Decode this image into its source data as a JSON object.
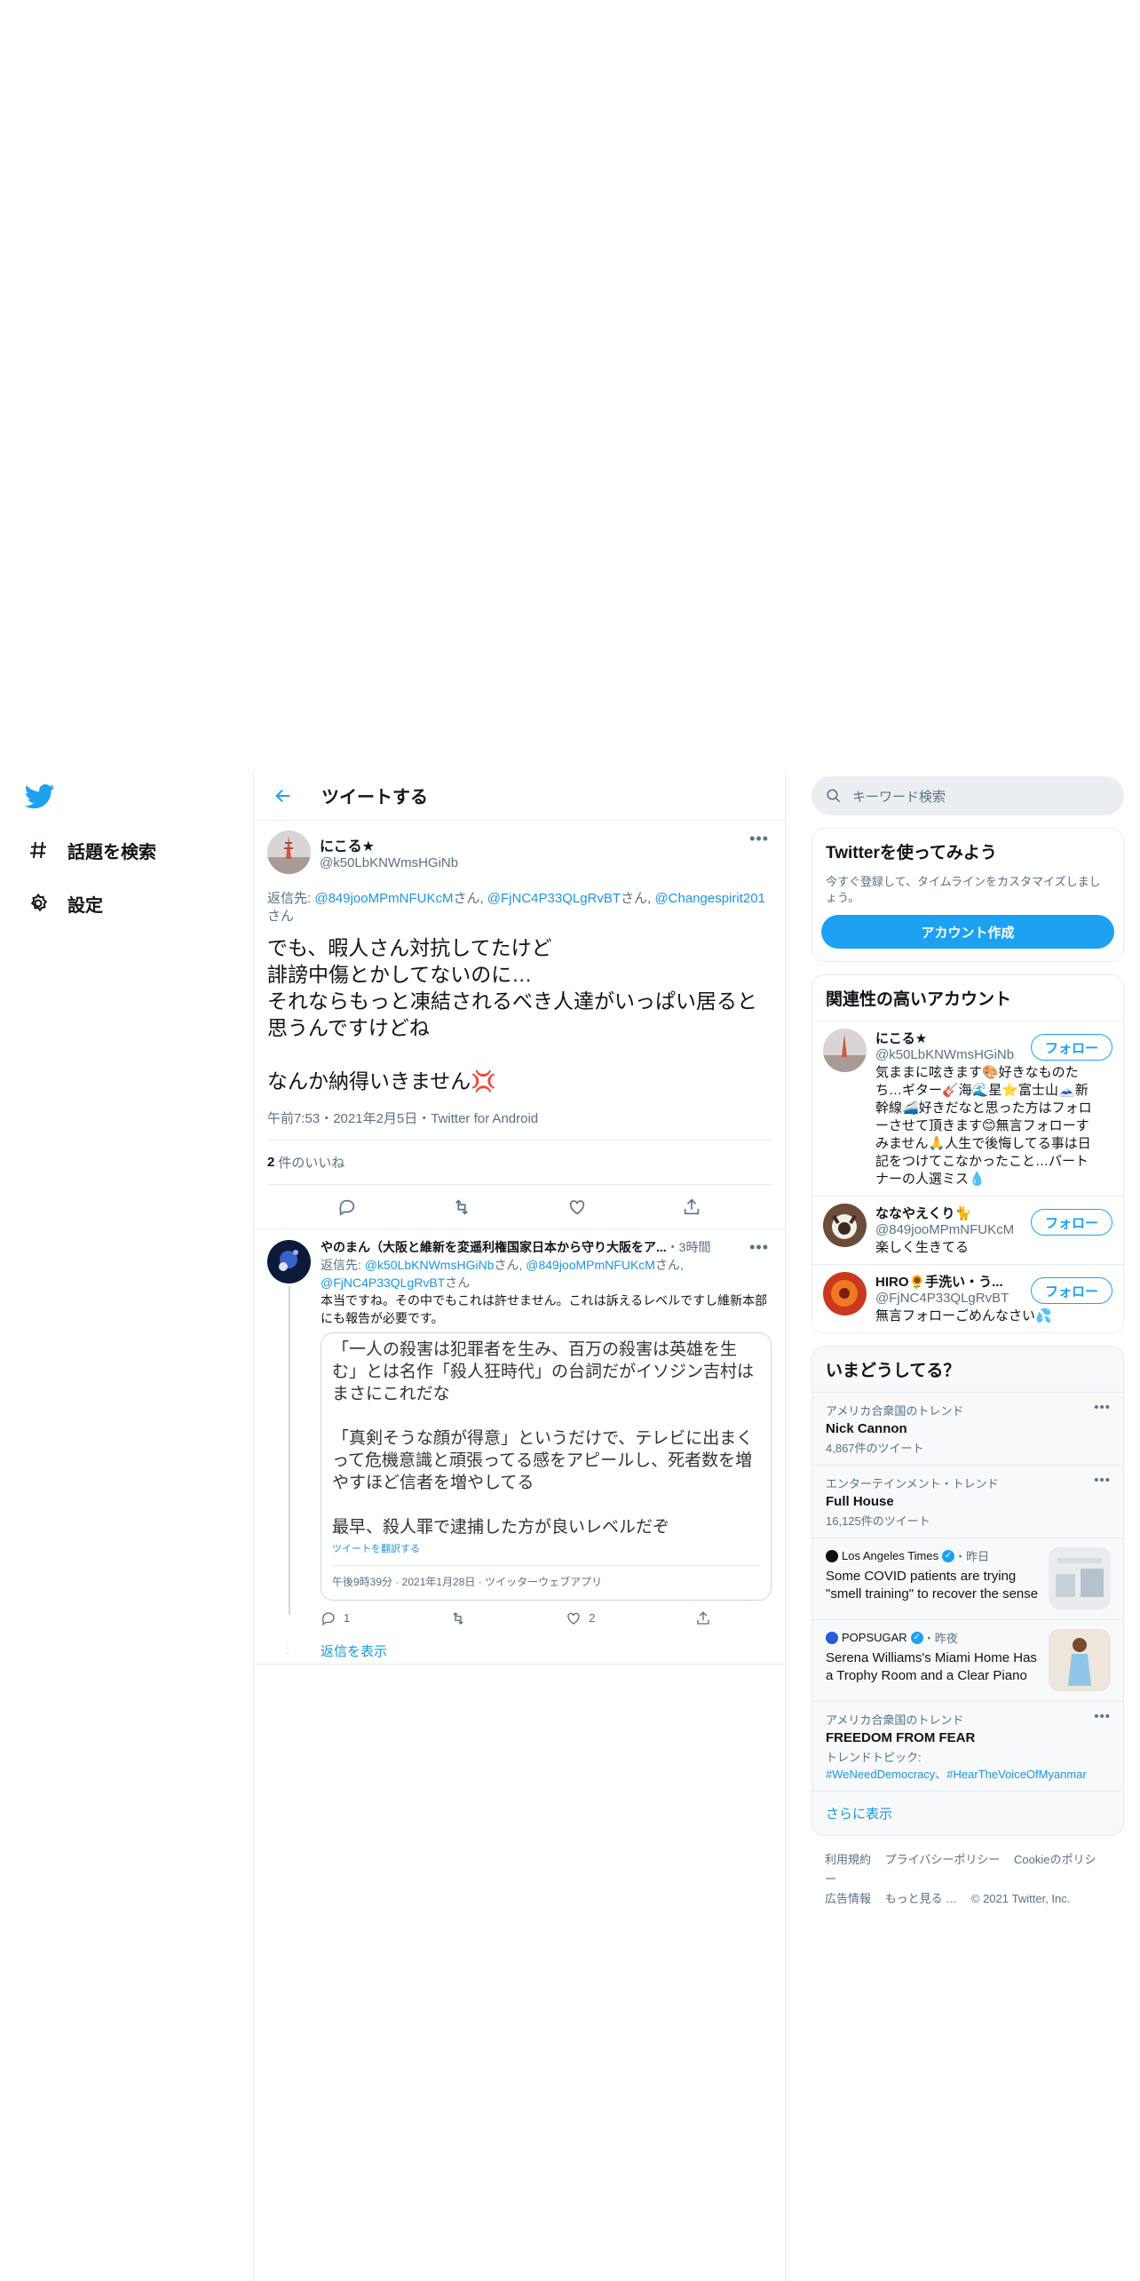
{
  "nav": {
    "items": [
      {
        "label": "話題を検索",
        "icon": "hashtag-icon"
      },
      {
        "label": "設定",
        "icon": "gear-icon"
      }
    ]
  },
  "header": {
    "title": "ツイートする"
  },
  "tweet": {
    "display_name": "にこる★",
    "handle": "@k50LbKNWmsHGiNb",
    "reply_prefix": "返信先: ",
    "reply_to": [
      "@849jooMPmNFUKcM",
      "@FjNC4P33QLgRvBT",
      "@Changespirit201"
    ],
    "reply_suffix": "さん",
    "text": "でも、暇人さん対抗してたけど\n誹謗中傷とかしてないのに…\nそれならもっと凍結されるべき人達がいっぱい居ると思うんですけどね\n\nなんか納得いきません💢",
    "meta": "午前7:53・2021年2月5日・Twitter for Android",
    "like_count": "2",
    "like_label": "件のいいね"
  },
  "reply": {
    "display_name": "やのまん（大阪と維新を変遥利権国家日本から守り大阪をア...",
    "time": "・3時間",
    "reply_prefix": "返信先: ",
    "reply_to_1": "@k50LbKNWmsHGiNb",
    "reply_to_2": "@849jooMPmNFUKcM",
    "reply_to_3": "@FjNC4P33QLgRvBT",
    "san": "さん",
    "text": "本当ですね。その中でもこれは許せません。これは訴えるレベルですし維新本部にも報告が必要です。",
    "quote_text": "「一人の殺害は犯罪者を生み、百万の殺害は英雄を生む」とは名作「殺人狂時代」の台詞だがイソジン吉村はまさにこれだな\n\n「真剣そうな顔が得意」というだけで、テレビに出まくって危機意識と頑張ってる感をアピールし、死者数を増やすほど信者を増やしてる\n\n最早、殺人罪で逮捕した方が良いレベルだぞ",
    "quote_translate": "ツイートを翻訳する",
    "quote_meta": "午後9時39分 · 2021年1月28日 · ツイッターウェブアプリ",
    "reply_count": "1",
    "like_count": "2",
    "show_replies": "返信を表示"
  },
  "right": {
    "search_placeholder": "キーワード検索",
    "signup": {
      "title": "Twitterを使ってみよう",
      "text": "今すぐ登録して、タイムラインをカスタマイズしましょう。",
      "button": "アカウント作成"
    },
    "related": {
      "title": "関連性の高いアカウント",
      "follow_label": "フォロー",
      "accounts": [
        {
          "name": "にこる★",
          "handle": "@k50LbKNWmsHGiNb",
          "bio": "気ままに呟きます🎨好きなものたち…ギター🎸海🌊星⭐富士山🗻新幹線🚄好きだなと思った方はフォローさせて頂きます😊無言フォローすみません🙏人生で後悔してる事は日記をつけてこなかったこと…パートナーの人選ミス💧"
        },
        {
          "name": "ななやえくり🐈",
          "handle": "@849jooMPmNFUKcM",
          "bio": "楽しく生きてる"
        },
        {
          "name": "HIRO🌻手洗い・う...",
          "handle": "@FjNC4P33QLgRvBT",
          "bio": "無言フォローごめんなさい💦"
        }
      ]
    },
    "trends": {
      "title": "いまどうしてる？",
      "items": [
        {
          "context": "アメリカ合衆国のトレンド",
          "name": "Nick Cannon",
          "count": "4,867件のツイート"
        },
        {
          "context": "エンターテインメント・トレンド",
          "name": "Full House",
          "count": "16,125件のツイート"
        }
      ],
      "news": [
        {
          "source": "Los Angeles Times",
          "time": "・昨日",
          "headline": "Some COVID patients are trying \"smell training\" to recover the sense"
        },
        {
          "source": "POPSUGAR",
          "time": "・昨夜",
          "headline": "Serena Williams's Miami Home Has a Trophy Room and a Clear Piano"
        }
      ],
      "trend3": {
        "context": "アメリカ合衆国のトレンド",
        "name": "FREEDOM FROM FEAR",
        "topic_label": "トレンドトピック:",
        "topics": "#WeNeedDemocracy、#HearTheVoiceOfMyanmar"
      },
      "show_more": "さらに表示"
    },
    "footer": {
      "links": [
        "利用規約",
        "プライバシーポリシー",
        "Cookieのポリシー",
        "広告情報",
        "もっと見る …"
      ],
      "copyright": "© 2021 Twitter, Inc."
    }
  },
  "colors": {
    "accent": "#1da1f2",
    "link": "#1b95e0",
    "muted": "#5b7083",
    "border": "#e6ecf0"
  }
}
